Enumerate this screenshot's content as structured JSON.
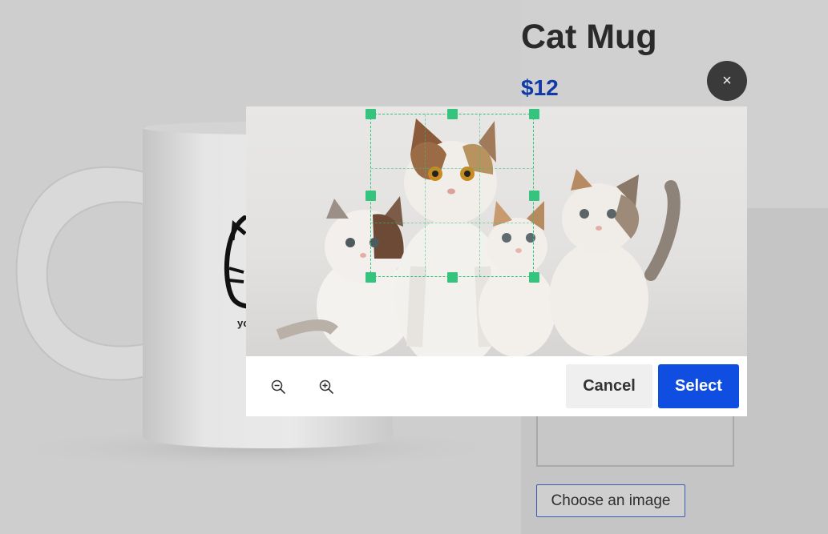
{
  "product": {
    "title": "Cat Mug",
    "price": "$12"
  },
  "uploader": {
    "choose_label": "Choose an image"
  },
  "modal": {
    "close_label": "×",
    "cancel_label": "Cancel",
    "select_label": "Select",
    "zoom_out_icon": "zoom-out-icon",
    "zoom_in_icon": "zoom-in-icon"
  },
  "colors": {
    "accent": "#0f4ee0",
    "price": "#0f3aa8",
    "crop_handle": "#35c47e"
  }
}
